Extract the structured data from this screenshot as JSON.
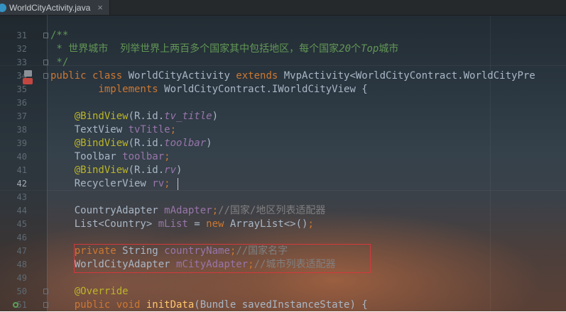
{
  "tab": {
    "filename": "WorldCityActivity.java",
    "close": "×",
    "icon": "java-class-icon"
  },
  "colors": {
    "keyword": "#cc7832",
    "annotation": "#bbb529",
    "field": "#9876aa",
    "comment": "#808080",
    "doc_comment": "#629755",
    "method": "#ffc66d",
    "text": "#a9b7c6",
    "highlight_box": "#d3383c"
  },
  "lines": [
    {
      "num": "31",
      "segments": [
        {
          "t": "/**",
          "c": "dc"
        }
      ]
    },
    {
      "num": "32",
      "segments": [
        {
          "t": " * 世界城市  列举世界上两百多个国家其中包括地区，每个国家",
          "c": "dc"
        },
        {
          "t": "20",
          "c": "dci"
        },
        {
          "t": "个",
          "c": "dc"
        },
        {
          "t": "Top",
          "c": "dci"
        },
        {
          "t": "城市",
          "c": "dc"
        }
      ]
    },
    {
      "num": "33",
      "segments": [
        {
          "t": " */",
          "c": "dc"
        }
      ]
    },
    {
      "num": "34",
      "segments": [
        {
          "t": "public class ",
          "c": "k"
        },
        {
          "t": "WorldCityActivity ",
          "c": ""
        },
        {
          "t": "extends ",
          "c": "k"
        },
        {
          "t": "MvpActivity<WorldCityContract.WorldCityPre",
          "c": ""
        }
      ]
    },
    {
      "num": "35",
      "segments": [
        {
          "t": "        implements ",
          "c": "k"
        },
        {
          "t": "WorldCityContract.IWorldCityView {",
          "c": ""
        }
      ]
    },
    {
      "num": "36",
      "segments": []
    },
    {
      "num": "37",
      "segments": [
        {
          "t": "    @BindView",
          "c": "ann"
        },
        {
          "t": "(R.id.",
          "c": ""
        },
        {
          "t": "tv_title",
          "c": "fldi"
        },
        {
          "t": ")",
          "c": ""
        }
      ]
    },
    {
      "num": "38",
      "segments": [
        {
          "t": "    TextView ",
          "c": ""
        },
        {
          "t": "tvTitle",
          "c": "fld"
        },
        {
          "t": ";",
          "c": "k"
        }
      ]
    },
    {
      "num": "39",
      "segments": [
        {
          "t": "    @BindView",
          "c": "ann"
        },
        {
          "t": "(R.id.",
          "c": ""
        },
        {
          "t": "toolbar",
          "c": "fldi"
        },
        {
          "t": ")",
          "c": ""
        }
      ]
    },
    {
      "num": "40",
      "segments": [
        {
          "t": "    Toolbar ",
          "c": ""
        },
        {
          "t": "toolbar",
          "c": "fld"
        },
        {
          "t": ";",
          "c": "k"
        }
      ]
    },
    {
      "num": "41",
      "segments": [
        {
          "t": "    @BindView",
          "c": "ann"
        },
        {
          "t": "(R.id.",
          "c": ""
        },
        {
          "t": "rv",
          "c": "fldi"
        },
        {
          "t": ")",
          "c": ""
        }
      ]
    },
    {
      "num": "42",
      "current": true,
      "segments": [
        {
          "t": "    RecyclerView ",
          "c": ""
        },
        {
          "t": "rv",
          "c": "fld"
        },
        {
          "t": ";",
          "c": "k"
        }
      ]
    },
    {
      "num": "43",
      "segments": []
    },
    {
      "num": "44",
      "segments": [
        {
          "t": "    CountryAdapter ",
          "c": ""
        },
        {
          "t": "mAdapter",
          "c": "fld"
        },
        {
          "t": ";",
          "c": "k"
        },
        {
          "t": "//国家/地区列表适配器",
          "c": "cm"
        }
      ]
    },
    {
      "num": "45",
      "segments": [
        {
          "t": "    List<Country> ",
          "c": ""
        },
        {
          "t": "mList ",
          "c": "fld"
        },
        {
          "t": "= ",
          "c": ""
        },
        {
          "t": "new ",
          "c": "k"
        },
        {
          "t": "ArrayList<>()",
          "c": ""
        },
        {
          "t": ";",
          "c": "k"
        }
      ]
    },
    {
      "num": "46",
      "segments": []
    },
    {
      "num": "47",
      "segments": [
        {
          "t": "    private ",
          "c": "k"
        },
        {
          "t": "String ",
          "c": ""
        },
        {
          "t": "countryName",
          "c": "fld"
        },
        {
          "t": ";",
          "c": "k"
        },
        {
          "t": "//国家名字",
          "c": "cm"
        }
      ]
    },
    {
      "num": "48",
      "segments": [
        {
          "t": "    WorldCityAdapter ",
          "c": ""
        },
        {
          "t": "mCityAdapter",
          "c": "fld"
        },
        {
          "t": ";",
          "c": "k"
        },
        {
          "t": "//城市列表适配器",
          "c": "cm"
        }
      ]
    },
    {
      "num": "49",
      "segments": []
    },
    {
      "num": "50",
      "segments": [
        {
          "t": "    @Override",
          "c": "ann"
        }
      ]
    },
    {
      "num": "51",
      "segments": [
        {
          "t": "    public void ",
          "c": "k"
        },
        {
          "t": "initData",
          "c": "fn"
        },
        {
          "t": "(Bundle savedInstanceState) {",
          "c": ""
        }
      ]
    }
  ]
}
